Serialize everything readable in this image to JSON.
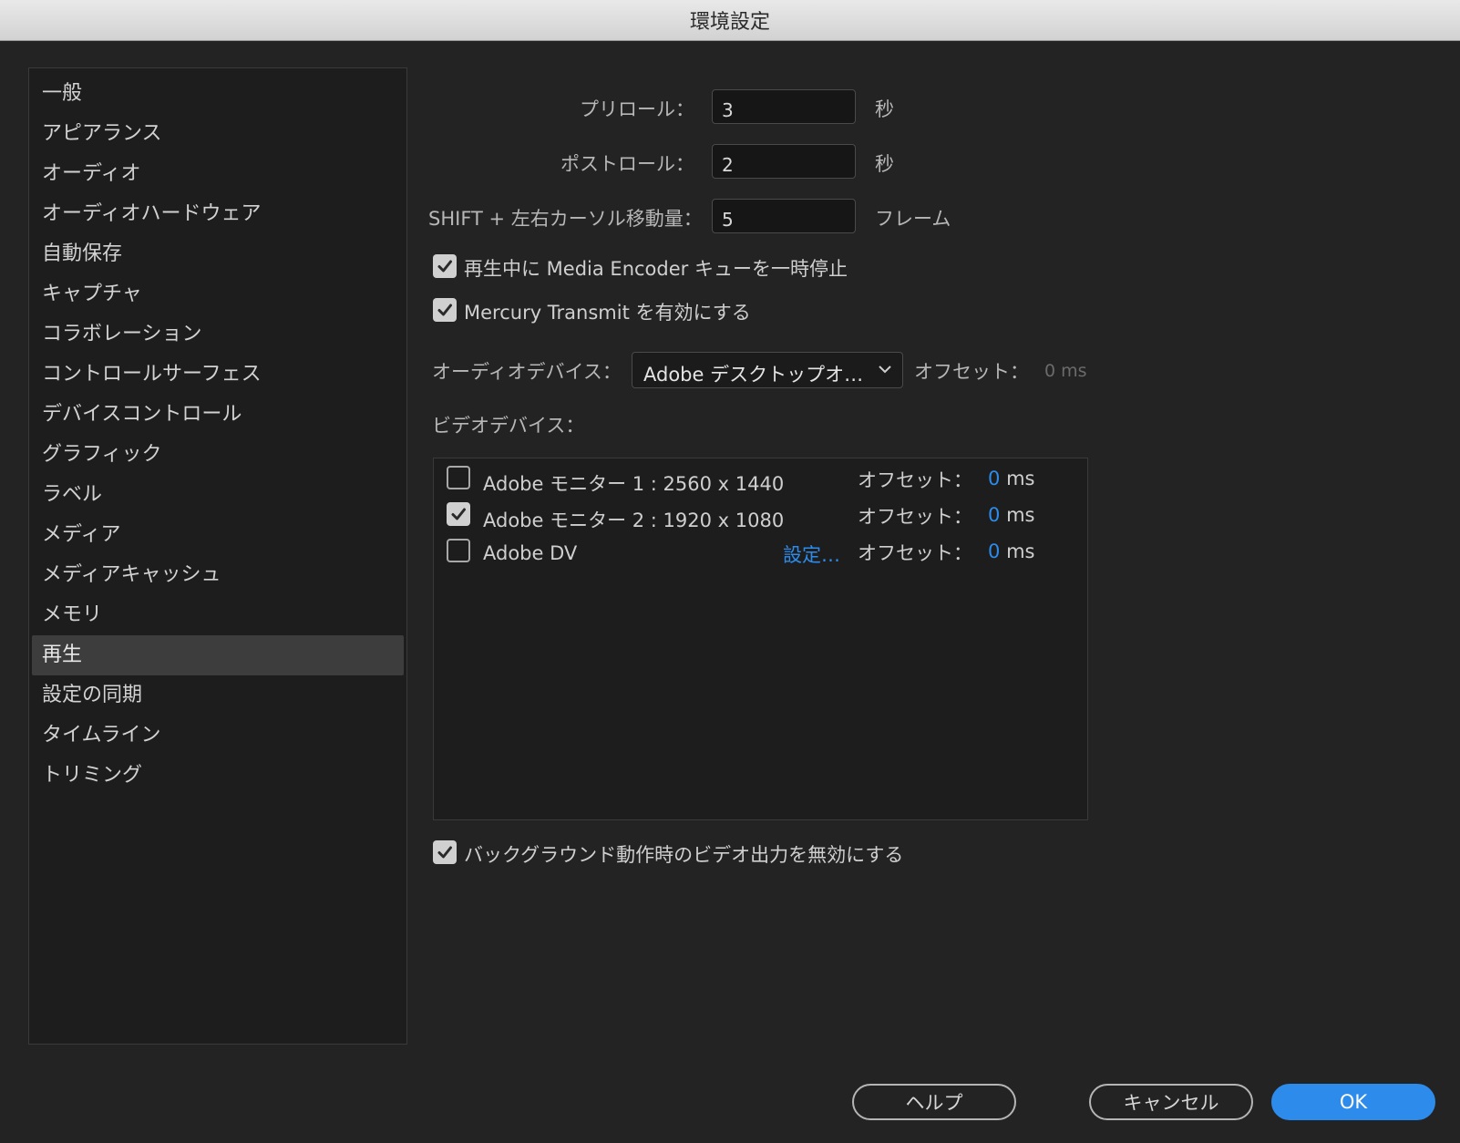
{
  "window": {
    "title": "環境設定"
  },
  "sidebar": {
    "items": [
      {
        "label": "一般"
      },
      {
        "label": "アピアランス"
      },
      {
        "label": "オーディオ"
      },
      {
        "label": "オーディオハードウェア"
      },
      {
        "label": "自動保存"
      },
      {
        "label": "キャプチャ"
      },
      {
        "label": "コラボレーション"
      },
      {
        "label": "コントロールサーフェス"
      },
      {
        "label": "デバイスコントロール"
      },
      {
        "label": "グラフィック"
      },
      {
        "label": "ラベル"
      },
      {
        "label": "メディア"
      },
      {
        "label": "メディアキャッシュ"
      },
      {
        "label": "メモリ"
      },
      {
        "label": "再生",
        "selected": true
      },
      {
        "label": "設定の同期"
      },
      {
        "label": "タイムライン"
      },
      {
        "label": "トリミング"
      }
    ]
  },
  "playback": {
    "preroll": {
      "label": "プリロール：",
      "value": "3",
      "unit": "秒"
    },
    "postroll": {
      "label": "ポストロール：",
      "value": "2",
      "unit": "秒"
    },
    "shift_step": {
      "label": "SHIFT + 左右カーソル移動量：",
      "value": "5",
      "unit": "フレーム"
    },
    "pause_encoder": {
      "label": "再生中に Media Encoder キューを一時停止",
      "checked": true
    },
    "mercury_transmit": {
      "label": "Mercury Transmit を有効にする",
      "checked": true
    },
    "audio_device": {
      "label": "オーディオデバイス：",
      "selected": "Adobe デスクトップオ…",
      "offset_label": "オフセット：",
      "offset_value": "0 ms"
    },
    "video_devices": {
      "label": "ビデオデバイス：",
      "items": [
        {
          "name": "Adobe モニター 1 : 2560 x 1440",
          "checked": false,
          "offset_label": "オフセット：",
          "offset_value": "0",
          "offset_unit": "ms"
        },
        {
          "name": "Adobe モニター 2 : 1920 x 1080",
          "checked": true,
          "offset_label": "オフセット：",
          "offset_value": "0",
          "offset_unit": "ms"
        },
        {
          "name": "Adobe DV",
          "checked": false,
          "settings_link": "設定…",
          "offset_label": "オフセット：",
          "offset_value": "0",
          "offset_unit": "ms"
        }
      ]
    },
    "disable_bg_video": {
      "label": "バックグラウンド動作時のビデオ出力を無効にする",
      "checked": true
    }
  },
  "buttons": {
    "help": "ヘルプ",
    "cancel": "キャンセル",
    "ok": "OK"
  },
  "colors": {
    "accent": "#2d8ceb",
    "background": "#232323",
    "sidebar": "#1d1d1d"
  }
}
